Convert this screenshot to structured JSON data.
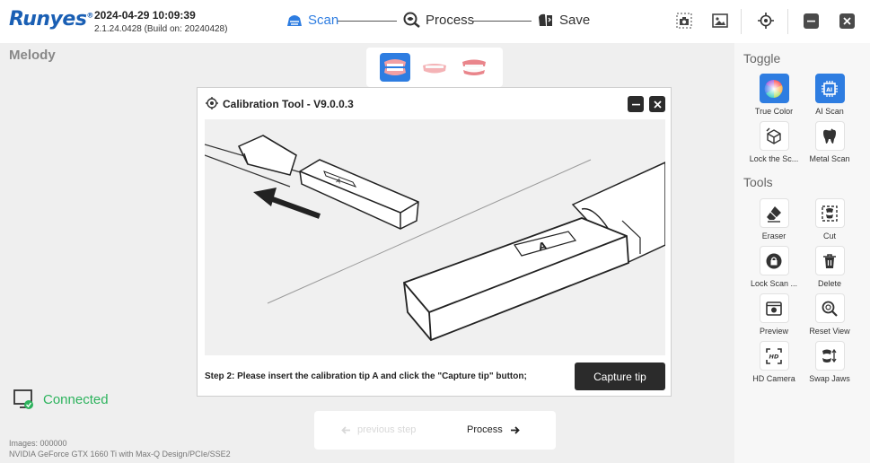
{
  "app": {
    "logo": "Runyes",
    "datetime": "2024-04-29 10:09:39",
    "version": "2.1.24.0428 (Build on: 20240428)"
  },
  "steps": [
    {
      "label": "Scan",
      "icon": "scan-icon",
      "active": true
    },
    {
      "label": "Process",
      "icon": "process-icon",
      "active": false
    },
    {
      "label": "Save",
      "icon": "save-icon",
      "active": false
    }
  ],
  "patient_name": "Melody",
  "dialog": {
    "title": "Calibration Tool - V9.0.0.3",
    "tip_label": "A",
    "instruction": "Step 2: Please insert the calibration tip A and click the \"Capture tip\" button;",
    "capture_button": "Capture tip"
  },
  "nav": {
    "previous": "previous step",
    "next": "Process"
  },
  "status": {
    "connected": "Connected",
    "images": "Images: 000000",
    "gpu": "NVIDIA GeForce GTX 1660 Ti with Max-Q Design/PCIe/SSE2"
  },
  "right_panel": {
    "toggle_title": "Toggle",
    "tools_title": "Tools",
    "toggles": [
      {
        "label": "True Color",
        "icon": "color-wheel-icon",
        "on": true
      },
      {
        "label": "AI Scan",
        "icon": "ai-chip-icon",
        "on": true
      },
      {
        "label": "Lock the Sc...",
        "icon": "cube-lock-icon",
        "on": false
      },
      {
        "label": "Metal Scan",
        "icon": "metal-tooth-icon",
        "on": false
      }
    ],
    "tools": [
      {
        "label": "Eraser",
        "icon": "eraser-icon"
      },
      {
        "label": "Cut",
        "icon": "cut-icon"
      },
      {
        "label": "Lock Scan ...",
        "icon": "lock-icon"
      },
      {
        "label": "Delete",
        "icon": "trash-icon"
      },
      {
        "label": "Preview",
        "icon": "preview-icon"
      },
      {
        "label": "Reset View",
        "icon": "magnifier-icon"
      },
      {
        "label": "HD Camera",
        "icon": "hd-camera-icon"
      },
      {
        "label": "Swap Jaws",
        "icon": "swap-jaws-icon"
      }
    ],
    "hd_badge": "HD"
  },
  "colors": {
    "accent": "#2e7de1",
    "connected": "#2db35d",
    "dark_button": "#2b2b2b"
  }
}
